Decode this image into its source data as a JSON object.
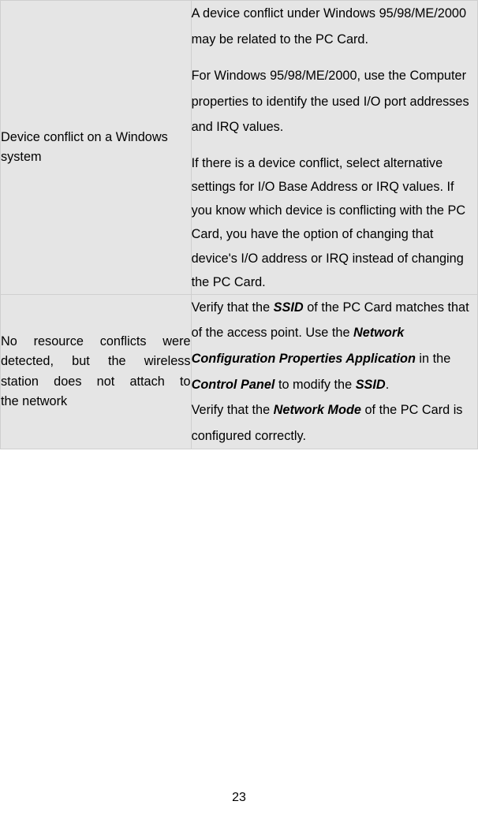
{
  "pageNumber": "23",
  "rows": [
    {
      "left": "Device conflict on a Windows system",
      "right_p1": "A device conflict under Windows 95/98/ME/2000 may be related to the PC Card.",
      "right_p2": "For Windows 95/98/ME/2000, use the Computer properties to identify the used I/O port addresses and IRQ values.",
      "right_p3": "If there is a device conflict, select alternative settings for I/O Base Address or IRQ values. If you know which device is conflicting with the PC Card, you have the option of changing that device's I/O address or IRQ instead of changing the PC Card."
    },
    {
      "left_l1": "No resource conflicts were",
      "left_l2": "detected, but the wireless",
      "left_l3": "station does not attach to",
      "left_l4": "the network",
      "right_seg1": "Verify that the ",
      "right_term1": "SSID",
      "right_seg2": " of the PC Card matches that of the access point. Use the ",
      "right_term2": "Network Configuration Properties Application",
      "right_seg3": " in the ",
      "right_term3": "Control Panel",
      "right_seg4": " to modify the ",
      "right_term4": "SSID",
      "right_seg5": ".",
      "right_line2a": "Verify that the ",
      "right_term5": "Network Mode",
      "right_line2b": " of the PC Card is configured correctly."
    }
  ]
}
